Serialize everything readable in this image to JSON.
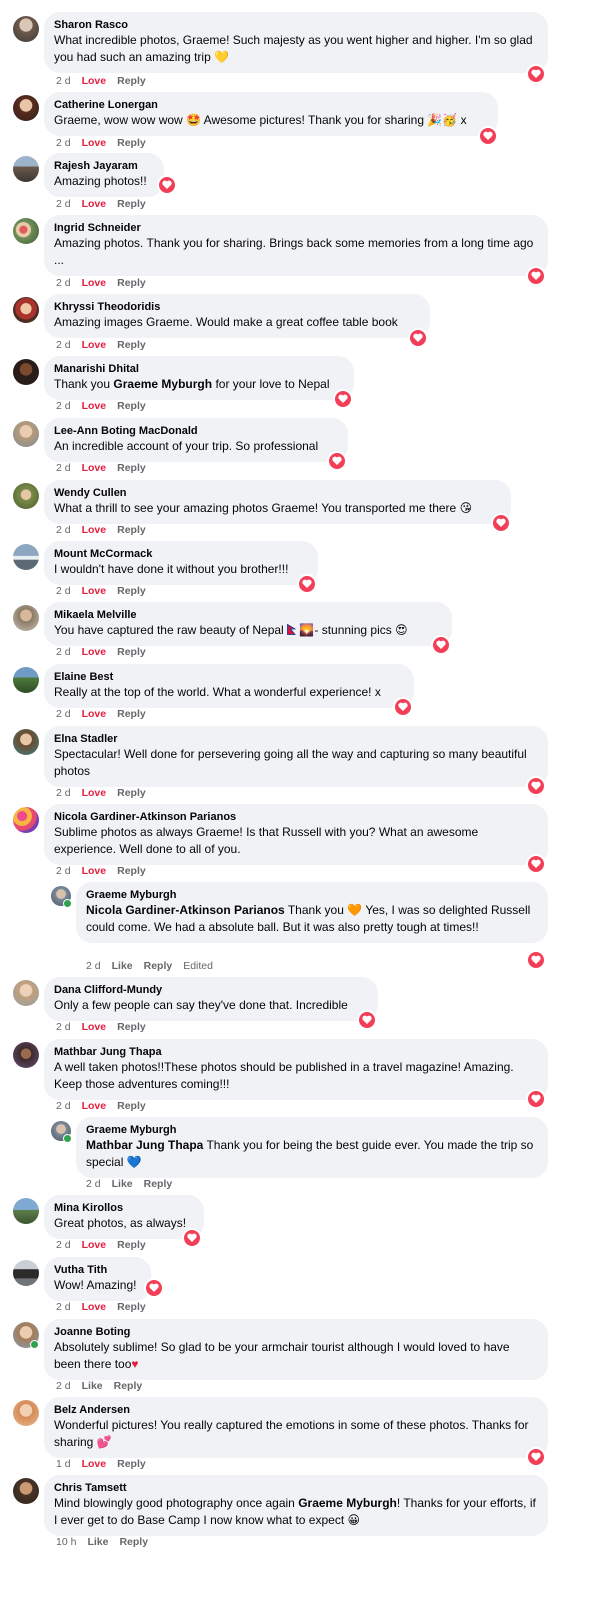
{
  "labels": {
    "love": "Love",
    "like": "Like",
    "reply": "Reply",
    "edited": "Edited"
  },
  "comments": [
    {
      "author": "Sharon Rasco",
      "text": "What incredible photos, Graeme! Such majesty as you went higher and higher. I'm so glad you had such an amazing trip",
      "time": "2 d",
      "reaction": "love",
      "emoji": "yellow-heart"
    },
    {
      "author": "Catherine Lonergan",
      "text": "Graeme, wow wow wow",
      "text2": "Awesome pictures! Thank you for sharing",
      "text3": "x",
      "time": "2 d",
      "reaction": "love"
    },
    {
      "author": "Rajesh Jayaram",
      "text": "Amazing photos!!",
      "time": "2 d",
      "reaction": "love"
    },
    {
      "author": "Ingrid Schneider",
      "text": "Amazing photos. Thank you for sharing. Brings back some memories from a long time ago ...",
      "time": "2 d",
      "reaction": "love"
    },
    {
      "author": "Khryssi Theodoridis",
      "text": "Amazing images Graeme. Would make a great coffee table book",
      "time": "2 d",
      "reaction": "love"
    },
    {
      "author": "Manarishi Dhital",
      "text": "Thank you",
      "mention": "Graeme Myburgh",
      "text2": "for your love to Nepal",
      "time": "2 d",
      "reaction": "love"
    },
    {
      "author": "Lee-Ann Boting MacDonald",
      "text": "An incredible account of your trip. So professional",
      "time": "2 d",
      "reaction": "love"
    },
    {
      "author": "Wendy Cullen",
      "text": "What a thrill to see your amazing photos Graeme! You transported me there",
      "time": "2 d",
      "reaction": "love"
    },
    {
      "author": "Mount McCormack",
      "text": "I wouldn't have done it without you brother!!!",
      "time": "2 d",
      "reaction": "love"
    },
    {
      "author": "Mikaela Melville",
      "text": "You have captured the raw beauty of Nepal",
      "text2": "- stunning pics",
      "time": "2 d",
      "reaction": "love"
    },
    {
      "author": "Elaine Best",
      "text": "Really at the top of the world. What a wonderful experience! x",
      "time": "2 d",
      "reaction": "love"
    },
    {
      "author": "Elna Stadler",
      "text": "Spectacular! Well done for persevering going all the way and capturing so many beautiful photos",
      "time": "2 d",
      "reaction": "love"
    },
    {
      "author": "Nicola Gardiner-Atkinson Parianos",
      "text": "Sublime photos as always Graeme! Is that Russell with you? What an awesome experience. Well done to all of you.",
      "time": "2 d",
      "reaction": "love"
    },
    {
      "author": "Graeme Myburgh",
      "mention": "Nicola Gardiner-Atkinson Parianos",
      "text": "Thank you",
      "text2": "Yes, I was so delighted Russell could come. We had a absolute ball. But it was also pretty tough at times!!",
      "time": "2 d",
      "reaction": "love",
      "edited": true
    },
    {
      "author": "Dana Clifford-Mundy",
      "text": "Only a few people can say they've done that. Incredible",
      "time": "2 d",
      "reaction": "love"
    },
    {
      "author": "Mathbar Jung Thapa",
      "text": "A well taken photos!!These photos should be published in a travel magazine! Amazing. Keep those adventures coming!!!",
      "time": "2 d",
      "reaction": "love"
    },
    {
      "author": "Graeme Myburgh",
      "mention": "Mathbar Jung Thapa",
      "text": "Thank you for being the best guide ever. You made the trip so special",
      "time": "2 d",
      "reaction": "none"
    },
    {
      "author": "Mina Kirollos",
      "text": "Great photos, as always!",
      "time": "2 d",
      "reaction": "love"
    },
    {
      "author": "Vutha Tith",
      "text": "Wow! Amazing!",
      "time": "2 d",
      "reaction": "love"
    },
    {
      "author": "Joanne Boting",
      "text": "Absolutely sublime! So glad to be your armchair tourist although I would loved to have been there too",
      "time": "2 d",
      "reaction": "none"
    },
    {
      "author": "Belz Andersen",
      "text": "Wonderful pictures! You really captured the emotions in some of these photos. Thanks for sharing",
      "time": "1 d",
      "reaction": "love"
    },
    {
      "author": "Chris Tamsett",
      "text": "Mind blowingly good photography once again",
      "mention": "Graeme Myburgh",
      "text2": "! Thanks for your efforts, if I ever get to do Base Camp I now know what to expect",
      "time": "10 h",
      "reaction": "none"
    }
  ],
  "colors": {
    "bubble": "#f0f2f5",
    "love": "#e41e3f",
    "love_badge": "#f33e58",
    "meta": "#65676b",
    "online": "#31a24c"
  }
}
